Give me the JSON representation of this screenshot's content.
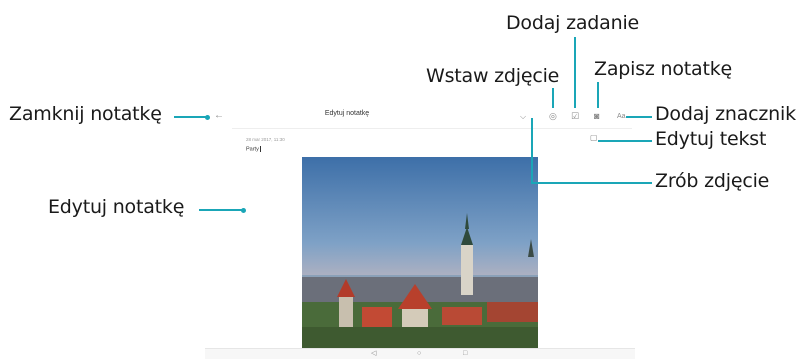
{
  "screen": {
    "title": "Edytuj notatkę",
    "date": "28 mar 2017, 11:30",
    "note_text": "Party"
  },
  "callouts": {
    "close_note": "Zamknij notatkę",
    "edit_note": "Edytuj notatkę",
    "insert_photo": "Wstaw zdjęcie",
    "add_task": "Dodaj zadanie",
    "save_note": "Zapisz notatkę",
    "add_tag": "Dodaj znacznik",
    "edit_text": "Edytuj tekst",
    "take_photo": "Zrób zdjęcie"
  },
  "toolbar": {
    "tag_label": "Aa"
  },
  "colors": {
    "callout_line": "#1aa6b7",
    "icon": "#8a8a8a"
  },
  "icons": [
    "back-arrow-icon",
    "chevron-down-icon",
    "gallery-icon",
    "checkbox-icon",
    "camera-icon",
    "text-format-icon",
    "text-edit-icon",
    "nav-back-icon",
    "nav-home-icon",
    "nav-recent-icon"
  ]
}
